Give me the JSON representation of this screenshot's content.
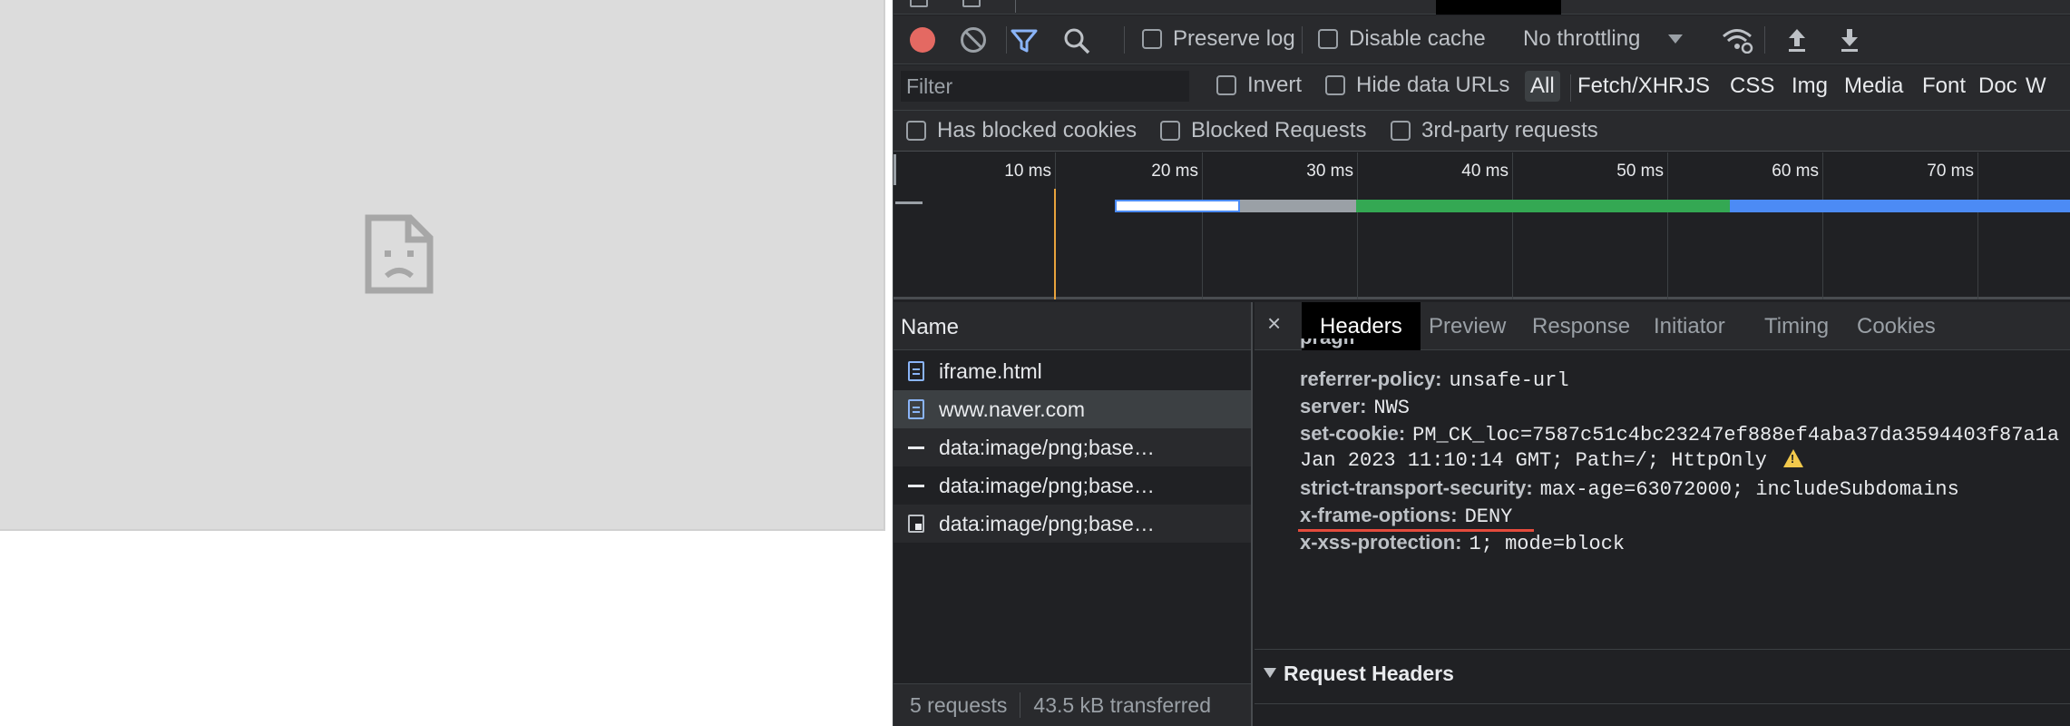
{
  "toolbar": {
    "preserve_log": "Preserve log",
    "disable_cache": "Disable cache",
    "throttling": "No throttling"
  },
  "filter_bar": {
    "placeholder": "Filter",
    "invert": "Invert",
    "hide_data_urls": "Hide data URLs",
    "types": [
      "All",
      "Fetch/XHR",
      "JS",
      "CSS",
      "Img",
      "Media",
      "Font",
      "Doc",
      "W"
    ]
  },
  "blocked_bar": {
    "has_blocked_cookies": "Has blocked cookies",
    "blocked_requests": "Blocked Requests",
    "third_party": "3rd-party requests"
  },
  "overview": {
    "ticks": [
      "10 ms",
      "20 ms",
      "30 ms",
      "40 ms",
      "50 ms",
      "60 ms",
      "70 ms"
    ]
  },
  "request_list": {
    "column_name": "Name",
    "rows": [
      {
        "name": "iframe.html",
        "icon": "document-icon"
      },
      {
        "name": "www.naver.com",
        "icon": "document-icon"
      },
      {
        "name": "data:image/png;base…",
        "icon": "line-icon"
      },
      {
        "name": "data:image/png;base…",
        "icon": "line-icon"
      },
      {
        "name": "data:image/png;base…",
        "icon": "image-icon"
      }
    ],
    "footer": {
      "requests": "5 requests",
      "transferred": "43.5 kB transferred"
    }
  },
  "detail": {
    "close": "×",
    "tabs": [
      "Headers",
      "Preview",
      "Response",
      "Initiator",
      "Timing",
      "Cookies"
    ],
    "response_headers": [
      {
        "name": "referrer-policy:",
        "value": "unsafe-url"
      },
      {
        "name": "server:",
        "value": "NWS"
      },
      {
        "name": "set-cookie:",
        "value": "PM_CK_loc=7587c51c4bc23247ef888ef4aba37da3594403f87a1a"
      },
      {
        "name": "strict-transport-security:",
        "value": "max-age=63072000; includeSubdomains"
      },
      {
        "name": "x-frame-options:",
        "value": "DENY"
      },
      {
        "name": "x-xss-protection:",
        "value": "1; mode=block"
      }
    ],
    "set_cookie_continuation": "Jan 2023 11:10:14 GMT; Path=/; HttpOnly",
    "request_headers_title": "Request Headers"
  },
  "colors": {
    "record": "#e46962",
    "filter_active": "#8ab4f8",
    "underline": "#e54b3c",
    "waterfall_white": "#ffffff",
    "waterfall_gray": "#9aa0a6",
    "waterfall_green": "#34a853",
    "waterfall_blue": "#4c8bf5"
  }
}
